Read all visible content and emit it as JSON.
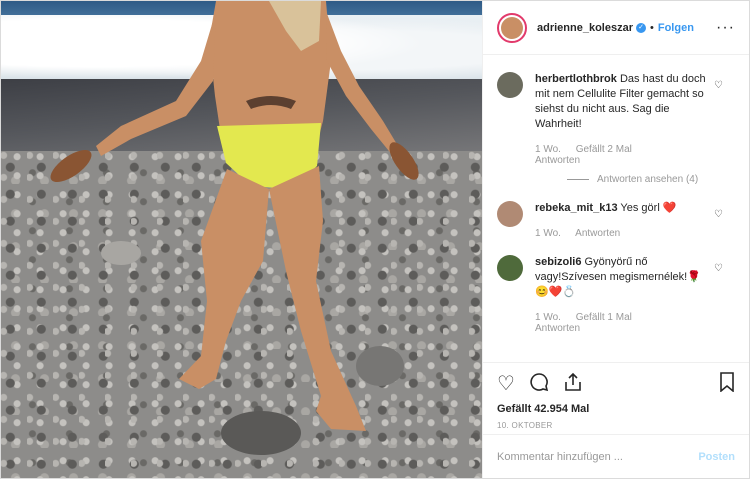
{
  "post": {
    "username": "adrienne_koleszar",
    "verified_mark": "✓",
    "separator": "•",
    "follow_label": "Folgen",
    "more_label": "···"
  },
  "comments": [
    {
      "username": "herbertlothbrok",
      "text": "Das hast du doch mit nem Cellulite Filter gemacht so siehst du nicht aus. Sag die Wahrheit!",
      "time": "1 Wo.",
      "likes": "Gefällt 2 Mal",
      "reply": "Antworten",
      "view_replies": "Antworten ansehen (4)"
    },
    {
      "username": "rebeka_mit_k13",
      "text": "Yes görl ❤️",
      "time": "1 Wo.",
      "likes": "",
      "reply": "Antworten"
    },
    {
      "username": "sebizoli6",
      "text": "Gyönyörű nő vagy!Szívesen megismernélek!🌹 😊❤️💍",
      "time": "1 Wo.",
      "likes": "Gefällt 1 Mal",
      "reply": "Antworten"
    }
  ],
  "actions": {
    "like_icon": "heart-outline",
    "comment_icon": "speech-bubble",
    "share_icon": "share-upload",
    "bookmark_icon": "bookmark",
    "likes_text": "Gefällt 42.954 Mal",
    "date_text": "10. OKTOBER"
  },
  "add_comment": {
    "placeholder": "Kommentar hinzufügen ...",
    "post_label": "Posten"
  },
  "colors": {
    "accent": "#3897f0",
    "post_disabled": "#b2dffc",
    "meta": "#999999"
  }
}
